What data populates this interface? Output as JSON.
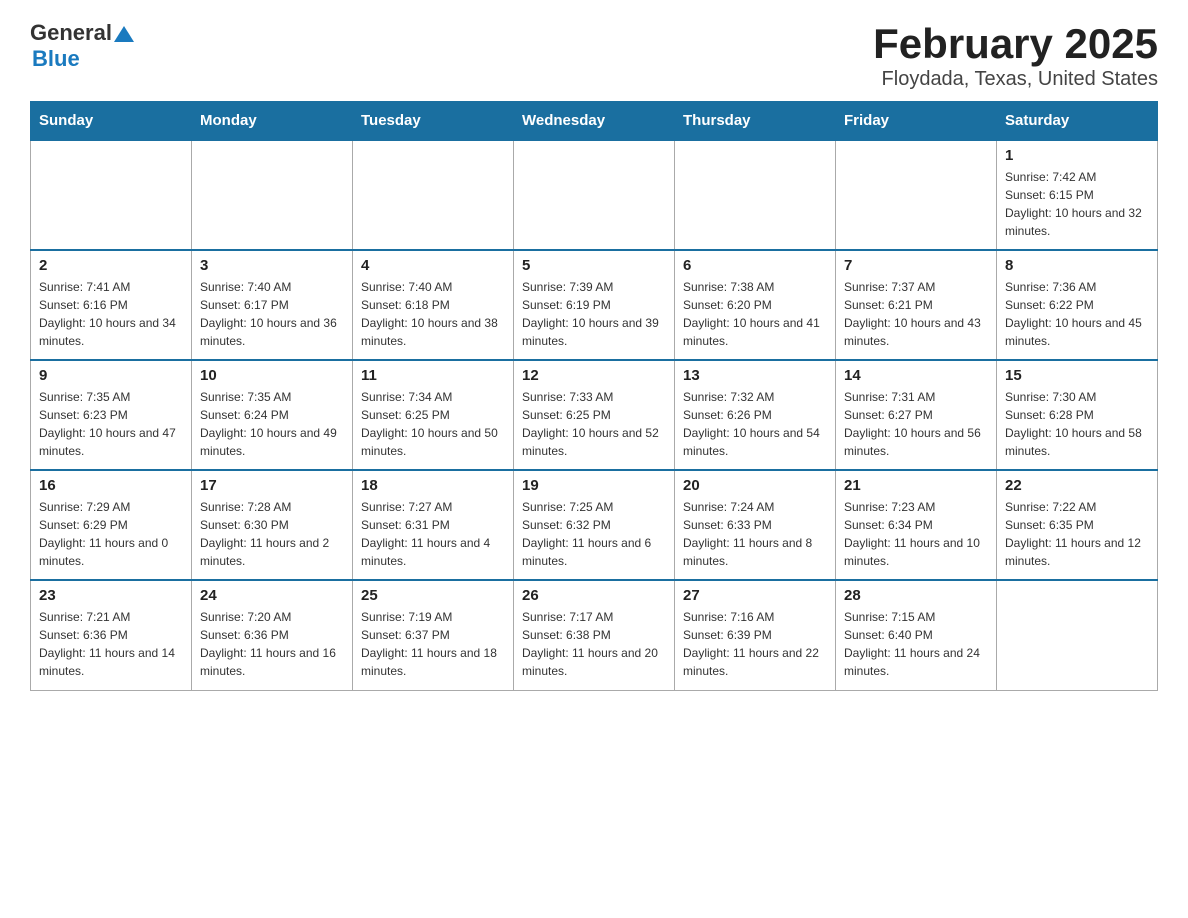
{
  "header": {
    "logo_general": "General",
    "logo_blue": "Blue",
    "month_title": "February 2025",
    "location": "Floydada, Texas, United States"
  },
  "days_of_week": [
    "Sunday",
    "Monday",
    "Tuesday",
    "Wednesday",
    "Thursday",
    "Friday",
    "Saturday"
  ],
  "weeks": [
    [
      {
        "day": "",
        "info": ""
      },
      {
        "day": "",
        "info": ""
      },
      {
        "day": "",
        "info": ""
      },
      {
        "day": "",
        "info": ""
      },
      {
        "day": "",
        "info": ""
      },
      {
        "day": "",
        "info": ""
      },
      {
        "day": "1",
        "info": "Sunrise: 7:42 AM\nSunset: 6:15 PM\nDaylight: 10 hours and 32 minutes."
      }
    ],
    [
      {
        "day": "2",
        "info": "Sunrise: 7:41 AM\nSunset: 6:16 PM\nDaylight: 10 hours and 34 minutes."
      },
      {
        "day": "3",
        "info": "Sunrise: 7:40 AM\nSunset: 6:17 PM\nDaylight: 10 hours and 36 minutes."
      },
      {
        "day": "4",
        "info": "Sunrise: 7:40 AM\nSunset: 6:18 PM\nDaylight: 10 hours and 38 minutes."
      },
      {
        "day": "5",
        "info": "Sunrise: 7:39 AM\nSunset: 6:19 PM\nDaylight: 10 hours and 39 minutes."
      },
      {
        "day": "6",
        "info": "Sunrise: 7:38 AM\nSunset: 6:20 PM\nDaylight: 10 hours and 41 minutes."
      },
      {
        "day": "7",
        "info": "Sunrise: 7:37 AM\nSunset: 6:21 PM\nDaylight: 10 hours and 43 minutes."
      },
      {
        "day": "8",
        "info": "Sunrise: 7:36 AM\nSunset: 6:22 PM\nDaylight: 10 hours and 45 minutes."
      }
    ],
    [
      {
        "day": "9",
        "info": "Sunrise: 7:35 AM\nSunset: 6:23 PM\nDaylight: 10 hours and 47 minutes."
      },
      {
        "day": "10",
        "info": "Sunrise: 7:35 AM\nSunset: 6:24 PM\nDaylight: 10 hours and 49 minutes."
      },
      {
        "day": "11",
        "info": "Sunrise: 7:34 AM\nSunset: 6:25 PM\nDaylight: 10 hours and 50 minutes."
      },
      {
        "day": "12",
        "info": "Sunrise: 7:33 AM\nSunset: 6:25 PM\nDaylight: 10 hours and 52 minutes."
      },
      {
        "day": "13",
        "info": "Sunrise: 7:32 AM\nSunset: 6:26 PM\nDaylight: 10 hours and 54 minutes."
      },
      {
        "day": "14",
        "info": "Sunrise: 7:31 AM\nSunset: 6:27 PM\nDaylight: 10 hours and 56 minutes."
      },
      {
        "day": "15",
        "info": "Sunrise: 7:30 AM\nSunset: 6:28 PM\nDaylight: 10 hours and 58 minutes."
      }
    ],
    [
      {
        "day": "16",
        "info": "Sunrise: 7:29 AM\nSunset: 6:29 PM\nDaylight: 11 hours and 0 minutes."
      },
      {
        "day": "17",
        "info": "Sunrise: 7:28 AM\nSunset: 6:30 PM\nDaylight: 11 hours and 2 minutes."
      },
      {
        "day": "18",
        "info": "Sunrise: 7:27 AM\nSunset: 6:31 PM\nDaylight: 11 hours and 4 minutes."
      },
      {
        "day": "19",
        "info": "Sunrise: 7:25 AM\nSunset: 6:32 PM\nDaylight: 11 hours and 6 minutes."
      },
      {
        "day": "20",
        "info": "Sunrise: 7:24 AM\nSunset: 6:33 PM\nDaylight: 11 hours and 8 minutes."
      },
      {
        "day": "21",
        "info": "Sunrise: 7:23 AM\nSunset: 6:34 PM\nDaylight: 11 hours and 10 minutes."
      },
      {
        "day": "22",
        "info": "Sunrise: 7:22 AM\nSunset: 6:35 PM\nDaylight: 11 hours and 12 minutes."
      }
    ],
    [
      {
        "day": "23",
        "info": "Sunrise: 7:21 AM\nSunset: 6:36 PM\nDaylight: 11 hours and 14 minutes."
      },
      {
        "day": "24",
        "info": "Sunrise: 7:20 AM\nSunset: 6:36 PM\nDaylight: 11 hours and 16 minutes."
      },
      {
        "day": "25",
        "info": "Sunrise: 7:19 AM\nSunset: 6:37 PM\nDaylight: 11 hours and 18 minutes."
      },
      {
        "day": "26",
        "info": "Sunrise: 7:17 AM\nSunset: 6:38 PM\nDaylight: 11 hours and 20 minutes."
      },
      {
        "day": "27",
        "info": "Sunrise: 7:16 AM\nSunset: 6:39 PM\nDaylight: 11 hours and 22 minutes."
      },
      {
        "day": "28",
        "info": "Sunrise: 7:15 AM\nSunset: 6:40 PM\nDaylight: 11 hours and 24 minutes."
      },
      {
        "day": "",
        "info": ""
      }
    ]
  ]
}
